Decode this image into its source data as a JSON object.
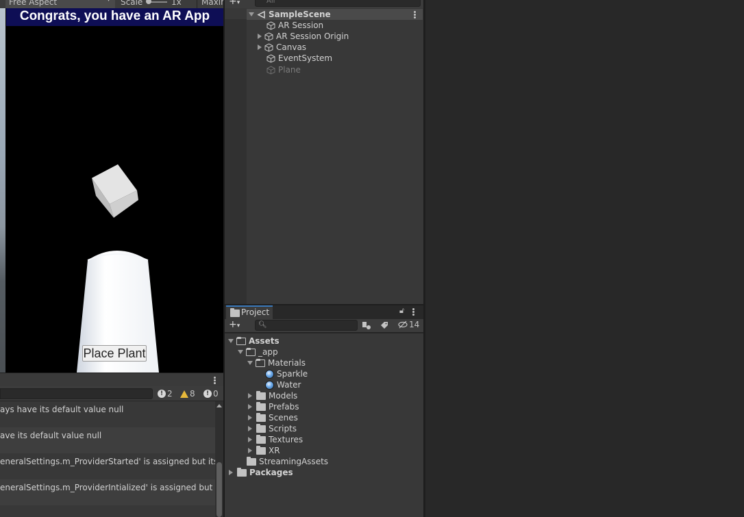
{
  "game_toolbar": {
    "aspect": "Free Aspect",
    "scale_label": "Scale",
    "scale_value": "1x",
    "maximize": "Maxin"
  },
  "game_view": {
    "banner_text": "Congrats, you have an AR App",
    "place_button": "Place Plant"
  },
  "console": {
    "error_count": "2",
    "warning_count": "8",
    "info_count": "0",
    "logs": [
      "ays have its default value null",
      "ave its default value null",
      "eneralSettings.m_ProviderStarted' is assigned but its valu",
      "eneralSettings.m_ProviderIntialized' is assigned but its va"
    ]
  },
  "hierarchy": {
    "search_placeholder": "All",
    "scene": "SampleScene",
    "items": [
      {
        "label": "AR Session",
        "expandable": false,
        "enabled": true
      },
      {
        "label": "AR Session Origin",
        "expandable": true,
        "enabled": true
      },
      {
        "label": "Canvas",
        "expandable": true,
        "enabled": true
      },
      {
        "label": "EventSystem",
        "expandable": false,
        "enabled": true
      },
      {
        "label": "Plane",
        "expandable": false,
        "enabled": false
      }
    ]
  },
  "project": {
    "tab_label": "Project",
    "hidden_count": "14",
    "tree": {
      "assets": "Assets",
      "app": "_app",
      "materials": "Materials",
      "sparkle": "Sparkle",
      "water": "Water",
      "models": "Models",
      "prefabs": "Prefabs",
      "scenes": "Scenes",
      "scripts": "Scripts",
      "textures": "Textures",
      "xr": "XR",
      "streaming": "StreamingAssets",
      "packages": "Packages"
    }
  },
  "colors": {
    "banner_bg": "#0e0e55",
    "selection_tab": "#3a79bb",
    "warning": "#e8b93a"
  }
}
